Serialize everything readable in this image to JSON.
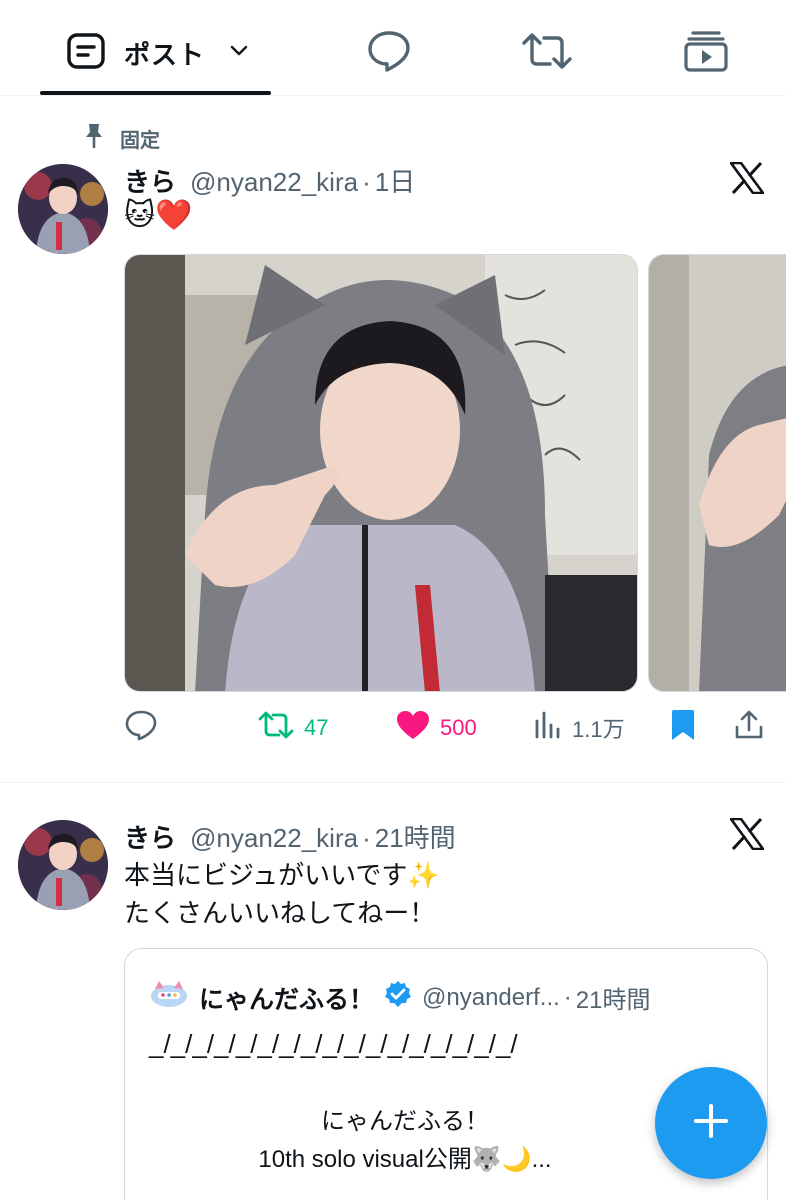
{
  "tabs": {
    "posts_label": "ポスト",
    "items": [
      "posts",
      "replies",
      "reposts",
      "media"
    ]
  },
  "post1": {
    "pinned_label": "固定",
    "author_name": "きら",
    "handle": "@nyan22_kira",
    "dot": "·",
    "time": "1日",
    "text": "🐱❤️",
    "metrics": {
      "replies": "",
      "reposts": "47",
      "likes": "500",
      "views": "1.1万"
    },
    "liked": true,
    "bookmarked": true
  },
  "post2": {
    "author_name": "きら",
    "handle": "@nyan22_kira",
    "dot": "·",
    "time": "21時間",
    "text_line1": "本当にビジュがいいです✨",
    "text_line2": "たくさんいいねしてねー！",
    "quote": {
      "author_name": "にゃんだふる！",
      "handle": "@nyanderf...",
      "dot": "·",
      "time": "21時間",
      "line": "_/_/_/_/_/_/_/_/_/_/_/_/_/_/_/_/_/",
      "body_line1": "にゃんだふる！",
      "body_line2": "10th solo visual公開🐺🌙..."
    }
  },
  "colors": {
    "text": "#0f1419",
    "secondary": "#536471",
    "repost": "#00ba7c",
    "like": "#f91880",
    "accent": "#1d9bf0"
  },
  "icons": [
    "timeline-icon",
    "chevron-down-icon",
    "reply-icon",
    "repost-icon",
    "media-icon",
    "pin-icon",
    "x-logo-icon",
    "heart-icon",
    "views-icon",
    "bookmark-icon",
    "share-icon",
    "verified-icon",
    "plus-icon"
  ]
}
